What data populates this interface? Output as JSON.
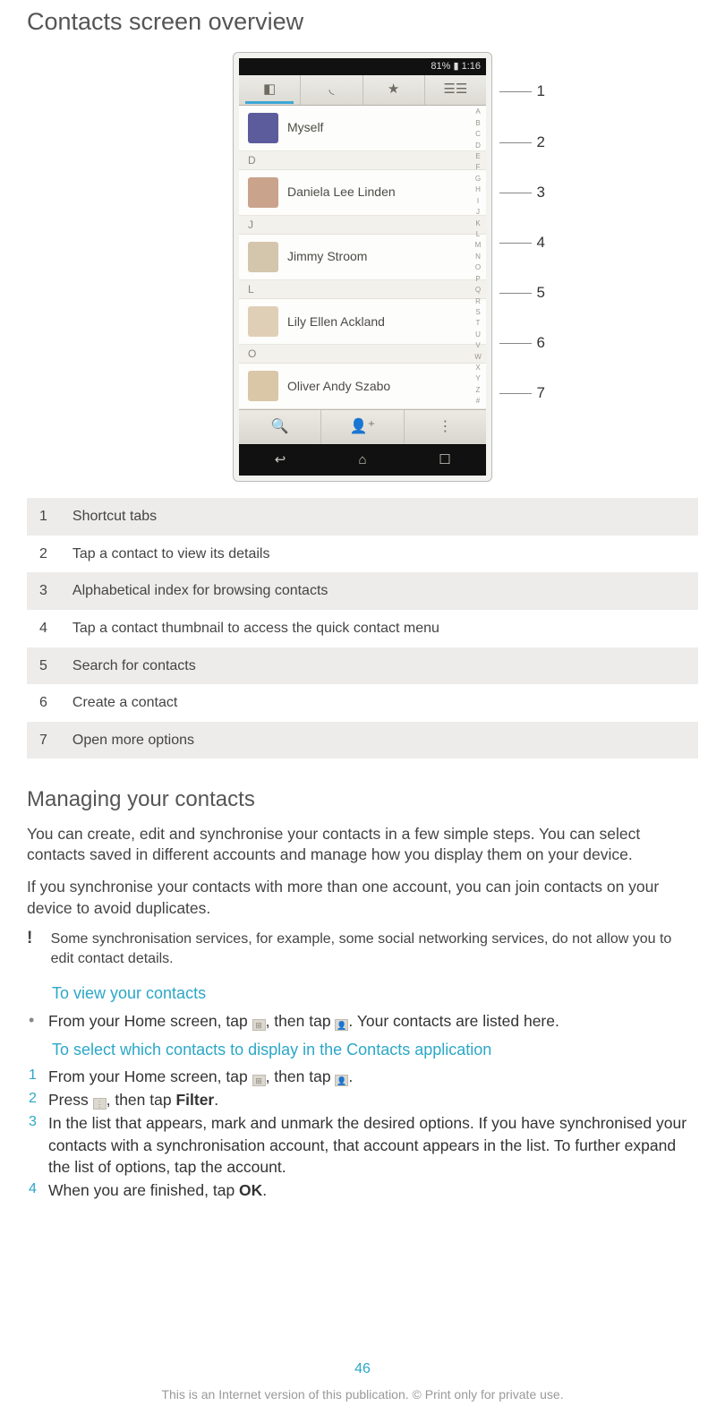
{
  "title": "Contacts screen overview",
  "phone": {
    "status": "81% ▮ 1:16",
    "tabs": [
      "◧",
      "◟",
      "★",
      "☰☰"
    ],
    "active_tab_index": 0,
    "contacts_alpha": [
      "A",
      "B",
      "C",
      "D",
      "E",
      "F",
      "G",
      "H",
      "I",
      "J",
      "K",
      "L",
      "M",
      "N",
      "O",
      "P",
      "Q",
      "R",
      "S",
      "T",
      "U",
      "V",
      "W",
      "X",
      "Y",
      "Z",
      "#"
    ],
    "sections": [
      {
        "head": "",
        "rows": [
          {
            "name": "Myself",
            "av": "me"
          }
        ]
      },
      {
        "head": "D",
        "rows": [
          {
            "name": "Daniela Lee Linden",
            "av": "d"
          }
        ]
      },
      {
        "head": "J",
        "rows": [
          {
            "name": "Jimmy Stroom",
            "av": "j"
          }
        ]
      },
      {
        "head": "L",
        "rows": [
          {
            "name": "Lily Ellen Ackland",
            "av": "l"
          }
        ]
      },
      {
        "head": "O",
        "rows": [
          {
            "name": "Oliver Andy Szabo",
            "av": "o"
          }
        ]
      }
    ],
    "bottom_icons": [
      "🔍",
      "👤⁺",
      "⋮"
    ],
    "nav_icons": [
      "↩",
      "⌂",
      "☐"
    ],
    "callouts": [
      "1",
      "2",
      "3",
      "4",
      "5",
      "6",
      "7"
    ]
  },
  "legend": [
    {
      "n": "1",
      "t": "Shortcut tabs"
    },
    {
      "n": "2",
      "t": "Tap a contact to view its details"
    },
    {
      "n": "3",
      "t": "Alphabetical index for browsing contacts"
    },
    {
      "n": "4",
      "t": "Tap a contact thumbnail to access the quick contact menu"
    },
    {
      "n": "5",
      "t": "Search for contacts"
    },
    {
      "n": "6",
      "t": "Create a contact"
    },
    {
      "n": "7",
      "t": "Open more options"
    }
  ],
  "managing": {
    "h": "Managing your contacts",
    "p1": "You can create, edit and synchronise your contacts in a few simple steps. You can select contacts saved in different accounts and manage how you display them on your device.",
    "p2": "If you synchronise your contacts with more than one account, you can join contacts on your device to avoid duplicates.",
    "note": "Some synchronisation services, for example, some social networking services, do not allow you to edit contact details.",
    "sub1": "To view your contacts",
    "s1_a": "From your Home screen, tap ",
    "s1_b": ", then tap ",
    "s1_c": ". Your contacts are listed here.",
    "sub2": "To select which contacts to display in the Contacts application",
    "steps2": [
      {
        "n": "1",
        "a": "From your Home screen, tap ",
        "b": ", then tap ",
        "c": "."
      },
      {
        "n": "2",
        "a": "Press ",
        "b": ", then tap ",
        "bold": "Filter",
        "c": "."
      },
      {
        "n": "3",
        "t": "In the list that appears, mark and unmark the desired options. If you have synchronised your contacts with a synchronisation account, that account appears in the list. To further expand the list of options, tap the account."
      },
      {
        "n": "4",
        "a": "When you are finished, tap ",
        "bold": "OK",
        "c": "."
      }
    ]
  },
  "footer": {
    "page": "46",
    "text": "This is an Internet version of this publication. © Print only for private use."
  },
  "icons": {
    "apps": "⊞",
    "contacts": "👤",
    "menu": "⋮"
  }
}
